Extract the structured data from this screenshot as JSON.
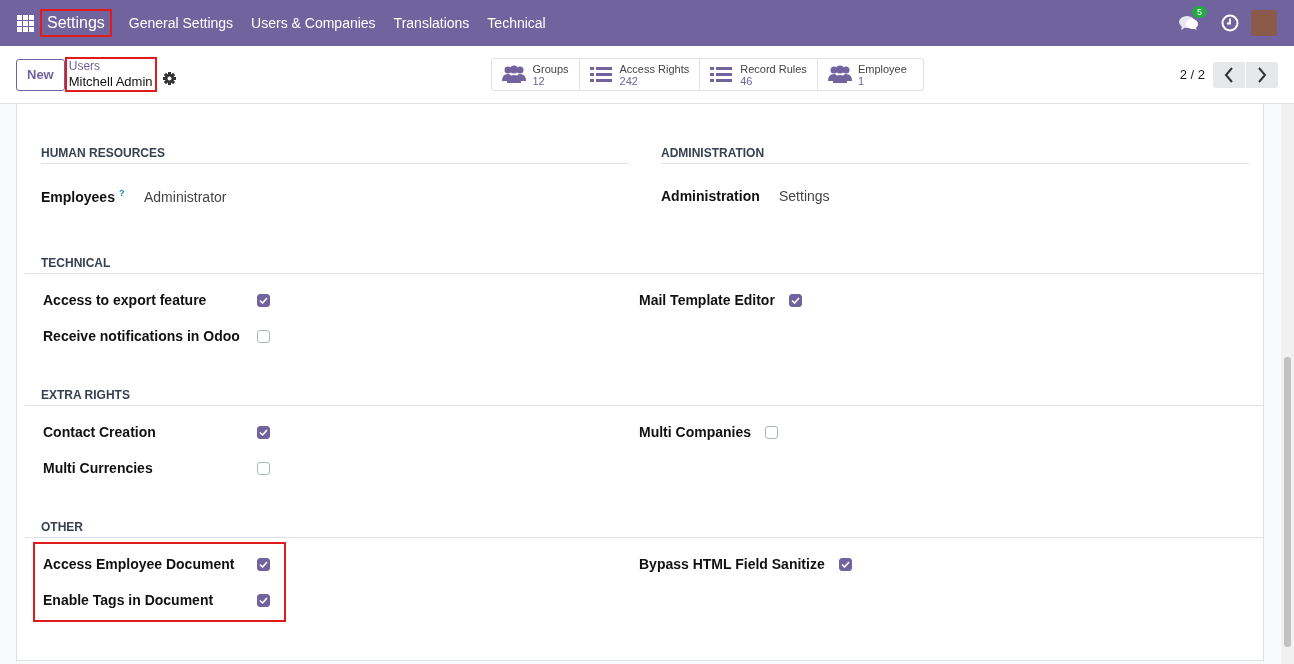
{
  "navbar": {
    "brand": {
      "label": "Settings",
      "highlighted": true
    },
    "menu": [
      "General Settings",
      "Users & Companies",
      "Translations",
      "Technical"
    ],
    "messages_badge": "5"
  },
  "control_panel": {
    "new_button": "New",
    "breadcrumb": {
      "parent": "Users",
      "current": "Mitchell Admin",
      "highlighted": true
    },
    "smart_buttons": [
      {
        "kind": "people",
        "label": "Groups",
        "count": "12"
      },
      {
        "kind": "list",
        "label": "Access Rights",
        "count": "242"
      },
      {
        "kind": "list",
        "label": "Record Rules",
        "count": "46"
      },
      {
        "kind": "people",
        "label": "Employee",
        "count": "1"
      }
    ],
    "pager": "2 / 2"
  },
  "split_sections": [
    {
      "title": "HUMAN RESOURCES",
      "field": {
        "label": "Employees",
        "help": "?",
        "value": "Administrator"
      }
    },
    {
      "title": "ADMINISTRATION",
      "field": {
        "label": "Administration",
        "value": "Settings"
      }
    }
  ],
  "sections": [
    {
      "title": "TECHNICAL",
      "left_highlighted": false,
      "left": [
        {
          "label": "Access to export feature",
          "checked": true
        },
        {
          "label": "Receive notifications in Odoo",
          "checked": false
        }
      ],
      "right": [
        {
          "label": "Mail Template Editor",
          "checked": true
        }
      ]
    },
    {
      "title": "EXTRA RIGHTS",
      "left_highlighted": false,
      "left": [
        {
          "label": "Contact Creation",
          "checked": true
        },
        {
          "label": "Multi Currencies",
          "checked": false
        }
      ],
      "right": [
        {
          "label": "Multi Companies",
          "checked": false
        }
      ]
    },
    {
      "title": "OTHER",
      "left_highlighted": true,
      "left": [
        {
          "label": "Access Employee Document",
          "checked": true
        },
        {
          "label": "Enable Tags in Document",
          "checked": true
        }
      ],
      "right": [
        {
          "label": "Bypass HTML Field Sanitize",
          "checked": true
        }
      ]
    }
  ]
}
